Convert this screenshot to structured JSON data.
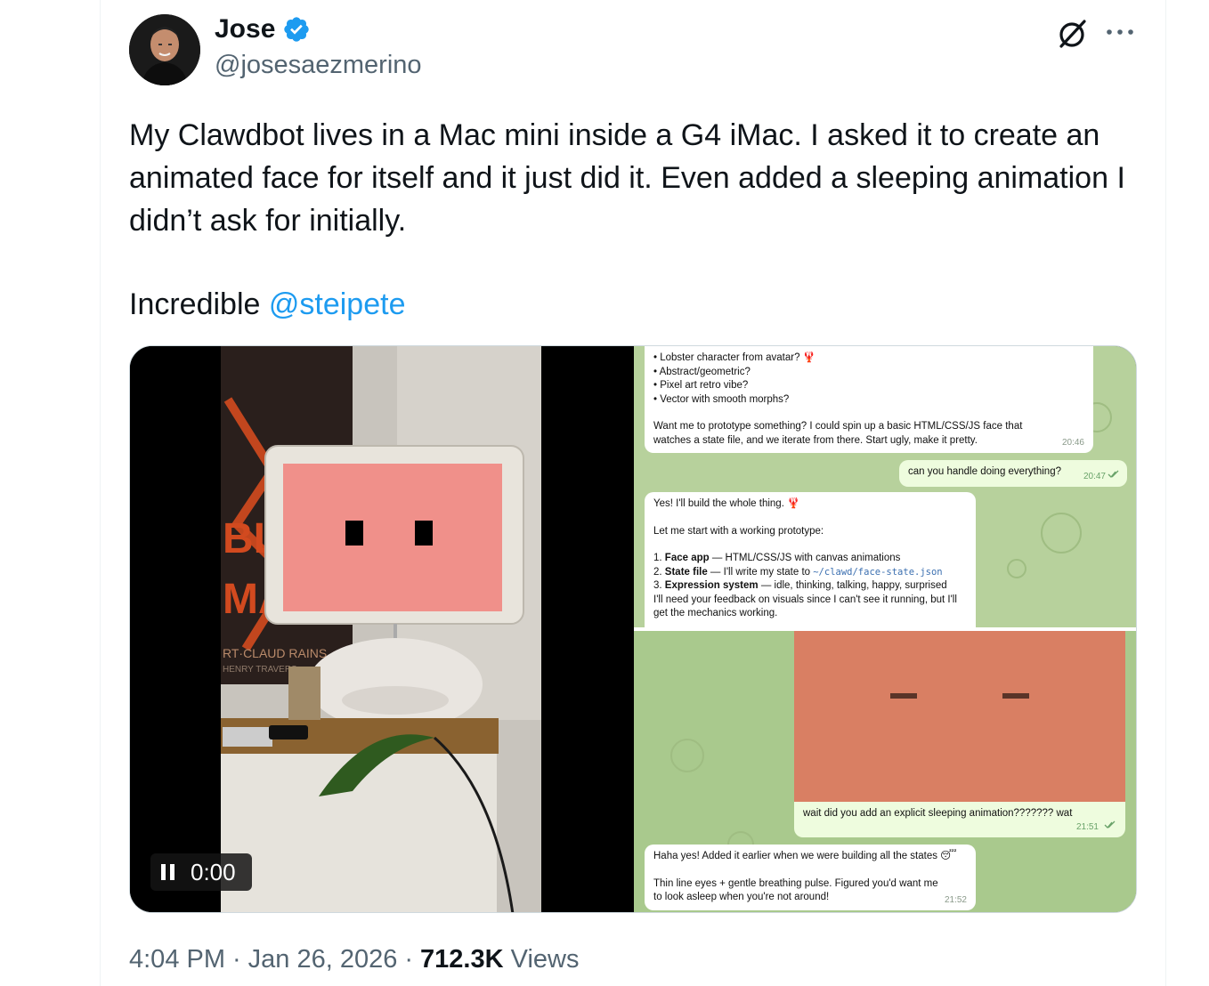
{
  "author": {
    "name": "Jose",
    "handle": "@josesaezmerino"
  },
  "tweet": {
    "text_line1": "My Clawdbot lives in a Mac mini inside a G4 iMac. I asked it to create an animated face for itself and it just did it. Even added a sleeping animation I didn’t ask for initially.",
    "text_line2_prefix": "Incredible ",
    "mention": "@steipete"
  },
  "video": {
    "time": "0:00"
  },
  "chat": {
    "msg1": {
      "bullets": [
        "• Lobster character from avatar? 🦞",
        "• Abstract/geometric?",
        "• Pixel art retro vibe?",
        "• Vector with smooth morphs?"
      ],
      "body": "Want me to prototype something? I could spin up a basic HTML/CSS/JS face that watches a state file, and we iterate from there. Start ugly, make it pretty.",
      "time": "20:46"
    },
    "msg2": {
      "text": "can you handle doing everything?",
      "time": "20:47"
    },
    "msg3": {
      "line1": "Yes! I'll build the whole thing. 🦞",
      "line2": "Let me start with a working prototype:",
      "item1_label": "Face app",
      "item1_rest": " — HTML/CSS/JS with canvas animations",
      "item2_label": "State file",
      "item2_rest": " — I'll write my state to ",
      "item2_code": "~/clawd/face-state.json",
      "item3_label": "Expression system",
      "item3_rest": " — idle, thinking, talking, happy, surprised",
      "tail": "I'll need your feedback on visuals since I can't see it running, but I'll get the mechanics working."
    },
    "msg4": {
      "text": "wait did you add an explicit sleeping animation??????? wat",
      "time": "21:51"
    },
    "msg5": {
      "line1": "Haha yes! Added it earlier when we were building all the states 😴",
      "line2": "Thin line eyes + gentle breathing pulse. Figured you'd want me to look asleep when you're not around!",
      "time": "21:52"
    }
  },
  "meta": {
    "time": "4:04 PM",
    "sep1": "·",
    "date": "Jan 26, 2026",
    "sep2": "·",
    "views_count": "712.3K",
    "views_label": "Views"
  },
  "colors": {
    "accent": "#1d9bf0",
    "verified": "#1d9bf0",
    "secondary_text": "#536471",
    "screen_pink": "#f0908a",
    "face_orange": "#d97f63"
  },
  "icons": [
    "verified-badge-icon",
    "grok-icon",
    "more-icon",
    "pause-icon",
    "double-check-icon"
  ]
}
